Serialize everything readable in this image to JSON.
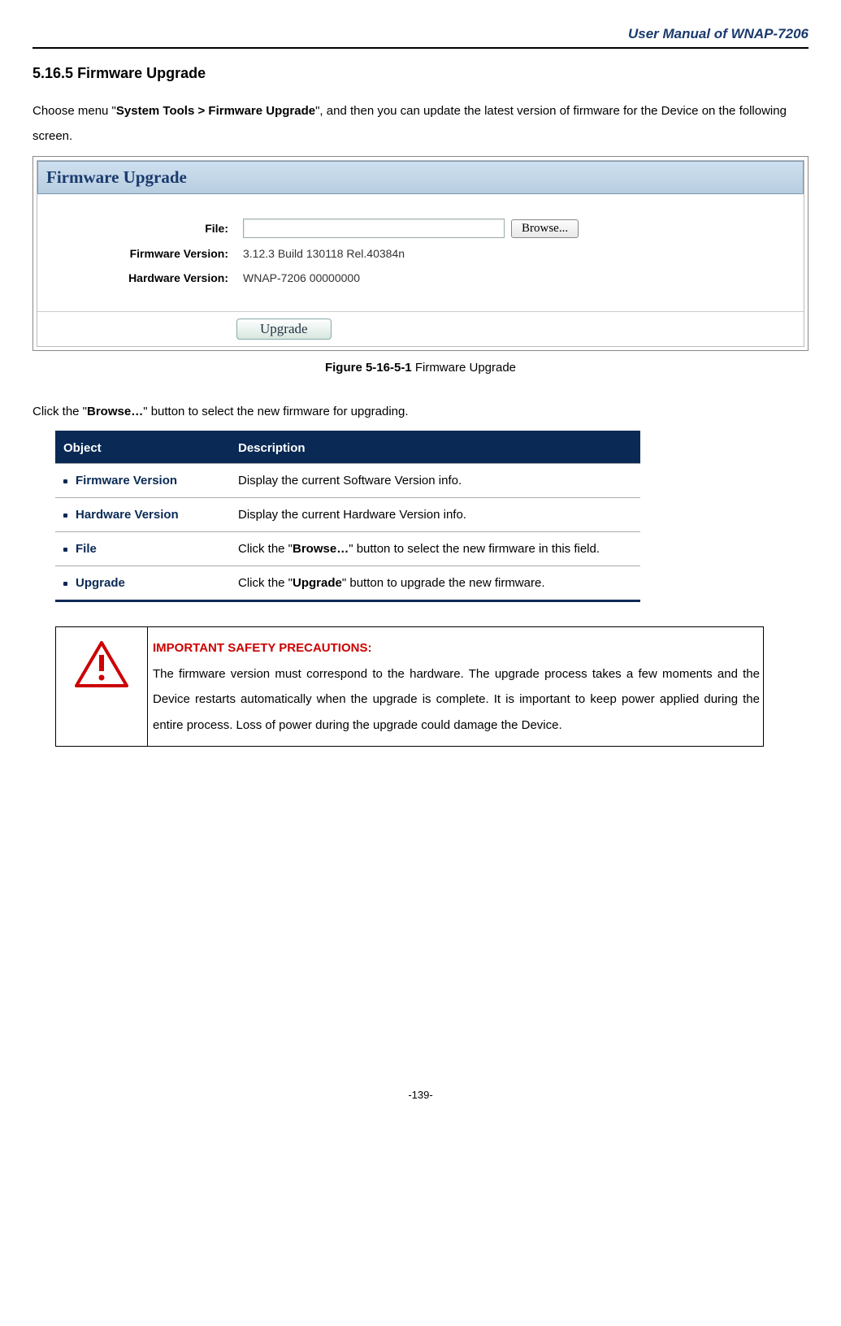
{
  "header": {
    "title": "User Manual of WNAP-7206"
  },
  "section": {
    "number": "5.16.5",
    "title": "Firmware Upgrade",
    "intro_pre": "Choose menu \"",
    "intro_bold": "System Tools > Firmware Upgrade",
    "intro_post": "\", and then you can update the latest version of firmware for the Device on the following screen."
  },
  "screenshot": {
    "heading": "Firmware Upgrade",
    "file_label": "File:",
    "browse": "Browse...",
    "fw_label": "Firmware Version:",
    "fw_value": "3.12.3 Build 130118 Rel.40384n",
    "hw_label": "Hardware Version:",
    "hw_value": "WNAP-7206 00000000",
    "upgrade": "Upgrade"
  },
  "caption": {
    "bold": "Figure 5-16-5-1",
    "rest": " Firmware Upgrade"
  },
  "click_line": {
    "pre": "Click the \"",
    "bold": "Browse…",
    "post": "\" button to select the new firmware for upgrading."
  },
  "table": {
    "h1": "Object",
    "h2": "Description",
    "rows": [
      {
        "obj": "Firmware Version",
        "desc_pre": "Display the current Software Version info.",
        "bold": "",
        "desc_post": ""
      },
      {
        "obj": "Hardware Version",
        "desc_pre": "Display the current Hardware Version info.",
        "bold": "",
        "desc_post": ""
      },
      {
        "obj": "File",
        "desc_pre": "Click the \"",
        "bold": "Browse…",
        "desc_post": "\" button to select the new firmware in this field."
      },
      {
        "obj": "Upgrade",
        "desc_pre": "Click the \"",
        "bold": "Upgrade",
        "desc_post": "\" button to upgrade the new firmware."
      }
    ]
  },
  "warning": {
    "title": "IMPORTANT SAFETY PRECAUTIONS:",
    "body": "The firmware version must correspond to the hardware. The upgrade process takes a few moments and the Device restarts automatically when the upgrade is complete. It is important to keep power applied during the entire process. Loss of power during the upgrade could damage the Device."
  },
  "page": "-139-"
}
